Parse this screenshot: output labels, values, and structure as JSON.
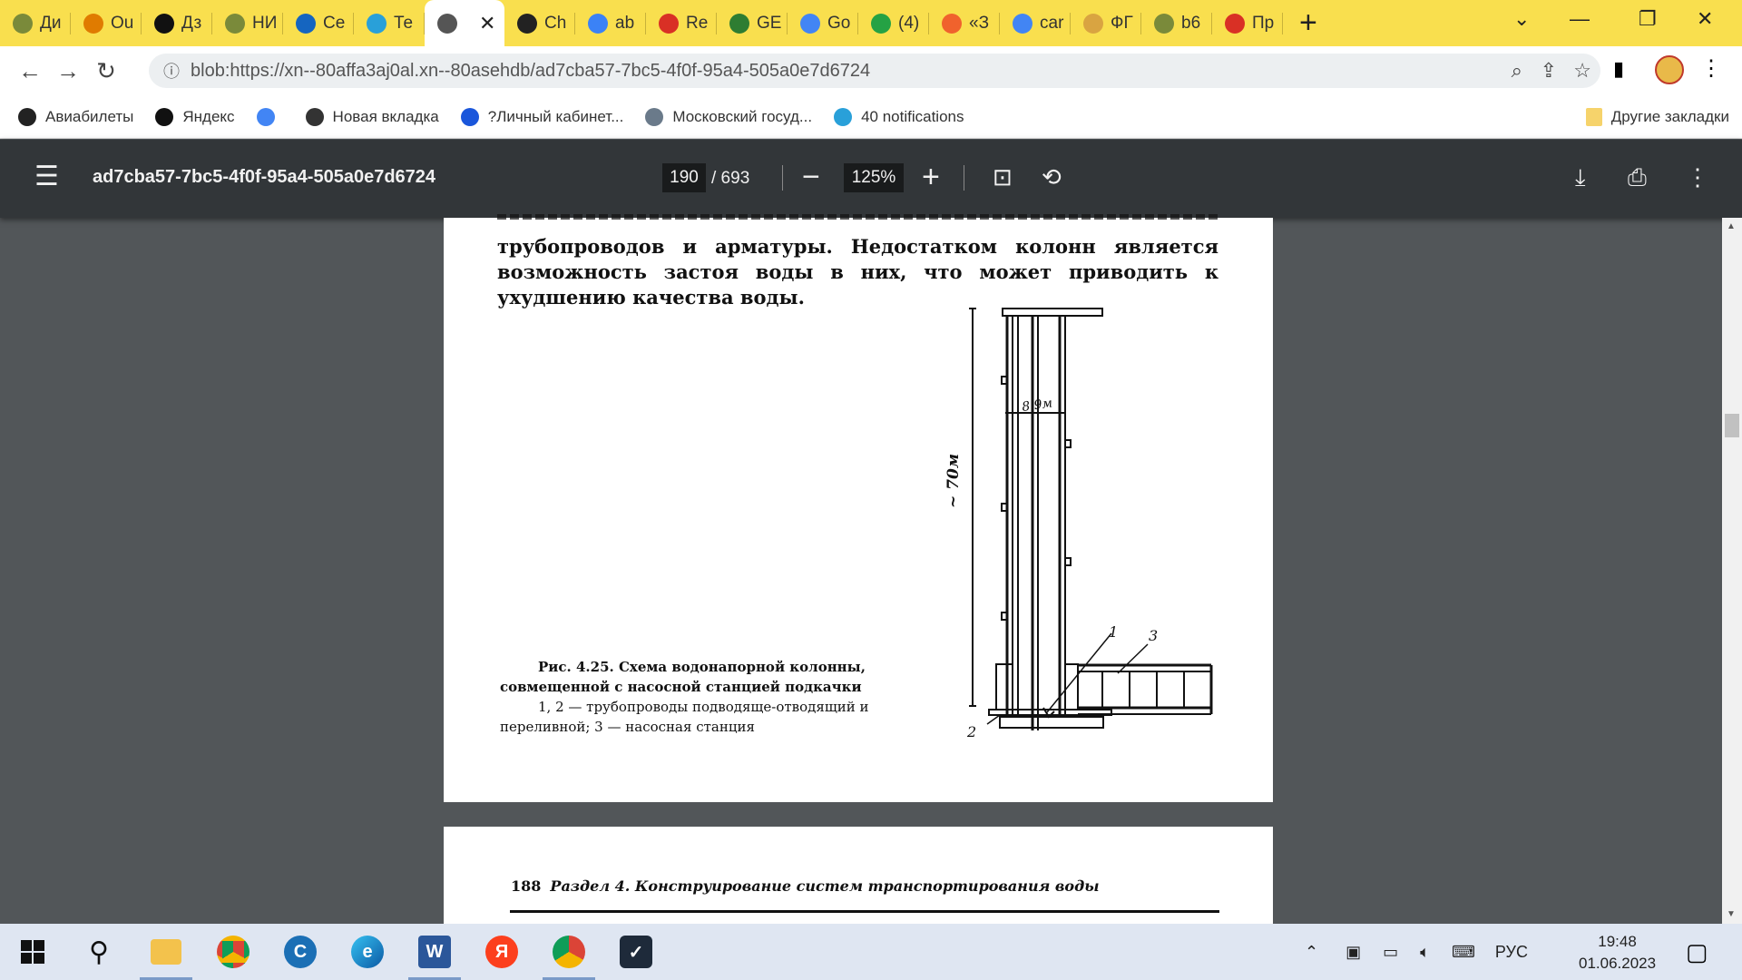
{
  "tabs": [
    {
      "label": "Ди",
      "color": "#7a8a3a"
    },
    {
      "label": "Ou",
      "color": "#e07b00"
    },
    {
      "label": "Дз",
      "color": "#111"
    },
    {
      "label": "НИ",
      "color": "#7a8a3a"
    },
    {
      "label": "Се",
      "color": "#1565c0"
    },
    {
      "label": "Те",
      "color": "#29a0d9"
    },
    {
      "label": "",
      "color": "#555",
      "active": true
    },
    {
      "label": "Ch",
      "color": "#222"
    },
    {
      "label": "ab",
      "color": "#3b82f6"
    },
    {
      "label": "Re",
      "color": "#d93025"
    },
    {
      "label": "GE",
      "color": "#2e7d32"
    },
    {
      "label": "Go",
      "color": "#4285f4"
    },
    {
      "label": "(4)",
      "color": "#25a244"
    },
    {
      "label": "«З",
      "color": "#f0622d"
    },
    {
      "label": "car",
      "color": "#4285f4"
    },
    {
      "label": "ФГ",
      "color": "#d9a441"
    },
    {
      "label": "b6",
      "color": "#7a8a3a"
    },
    {
      "label": "Пр",
      "color": "#d93025"
    }
  ],
  "address": {
    "url": "blob:https://xn--80affa3aj0al.xn--80asehdb/ad7cba57-7bc5-4f0f-95a4-505a0e7d6724"
  },
  "bookmarks": [
    {
      "label": "Авиабилеты",
      "color": "#222"
    },
    {
      "label": "Яндекс",
      "color": "#111"
    },
    {
      "label": "",
      "color": "#4285f4"
    },
    {
      "label": "Новая вкладка",
      "color": "#333"
    },
    {
      "label": "?Личный кабинет...",
      "color": "#1a56db"
    },
    {
      "label": "Московский госуд...",
      "color": "#6a7a8a"
    },
    {
      "label": "40 notifications",
      "color": "#29a0d9"
    }
  ],
  "other_bookmarks": "Другие закладки",
  "pdf": {
    "file_name": "ad7cba57-7bc5-4f0f-95a4-505a0e7d6724",
    "current_page": "190",
    "total_pages": "/ 693",
    "zoom": "125%"
  },
  "page_text": {
    "paragraph": "трубопроводов и арматуры. Недостатком колонн является возможность застоя воды в них, что может приводить к ухудшению качества воды.",
    "caption_title": "Рис. 4.25. Схема водонапорной колонны, совмещенной с насосной станцией подкачки",
    "caption_body": "1, 2 — трубопроводы подводяще-отводящий и переливной; 3 — насосная станция",
    "dim_height": "~ 70м",
    "dim_width": "8,9м",
    "label_1": "1",
    "label_2": "2",
    "label_3": "3"
  },
  "next_page": {
    "number": "188",
    "header": "Раздел 4. Конструирование систем транспортирования воды"
  },
  "taskbar": {
    "language": "РУС",
    "time": "19:48",
    "date": "01.06.2023"
  }
}
